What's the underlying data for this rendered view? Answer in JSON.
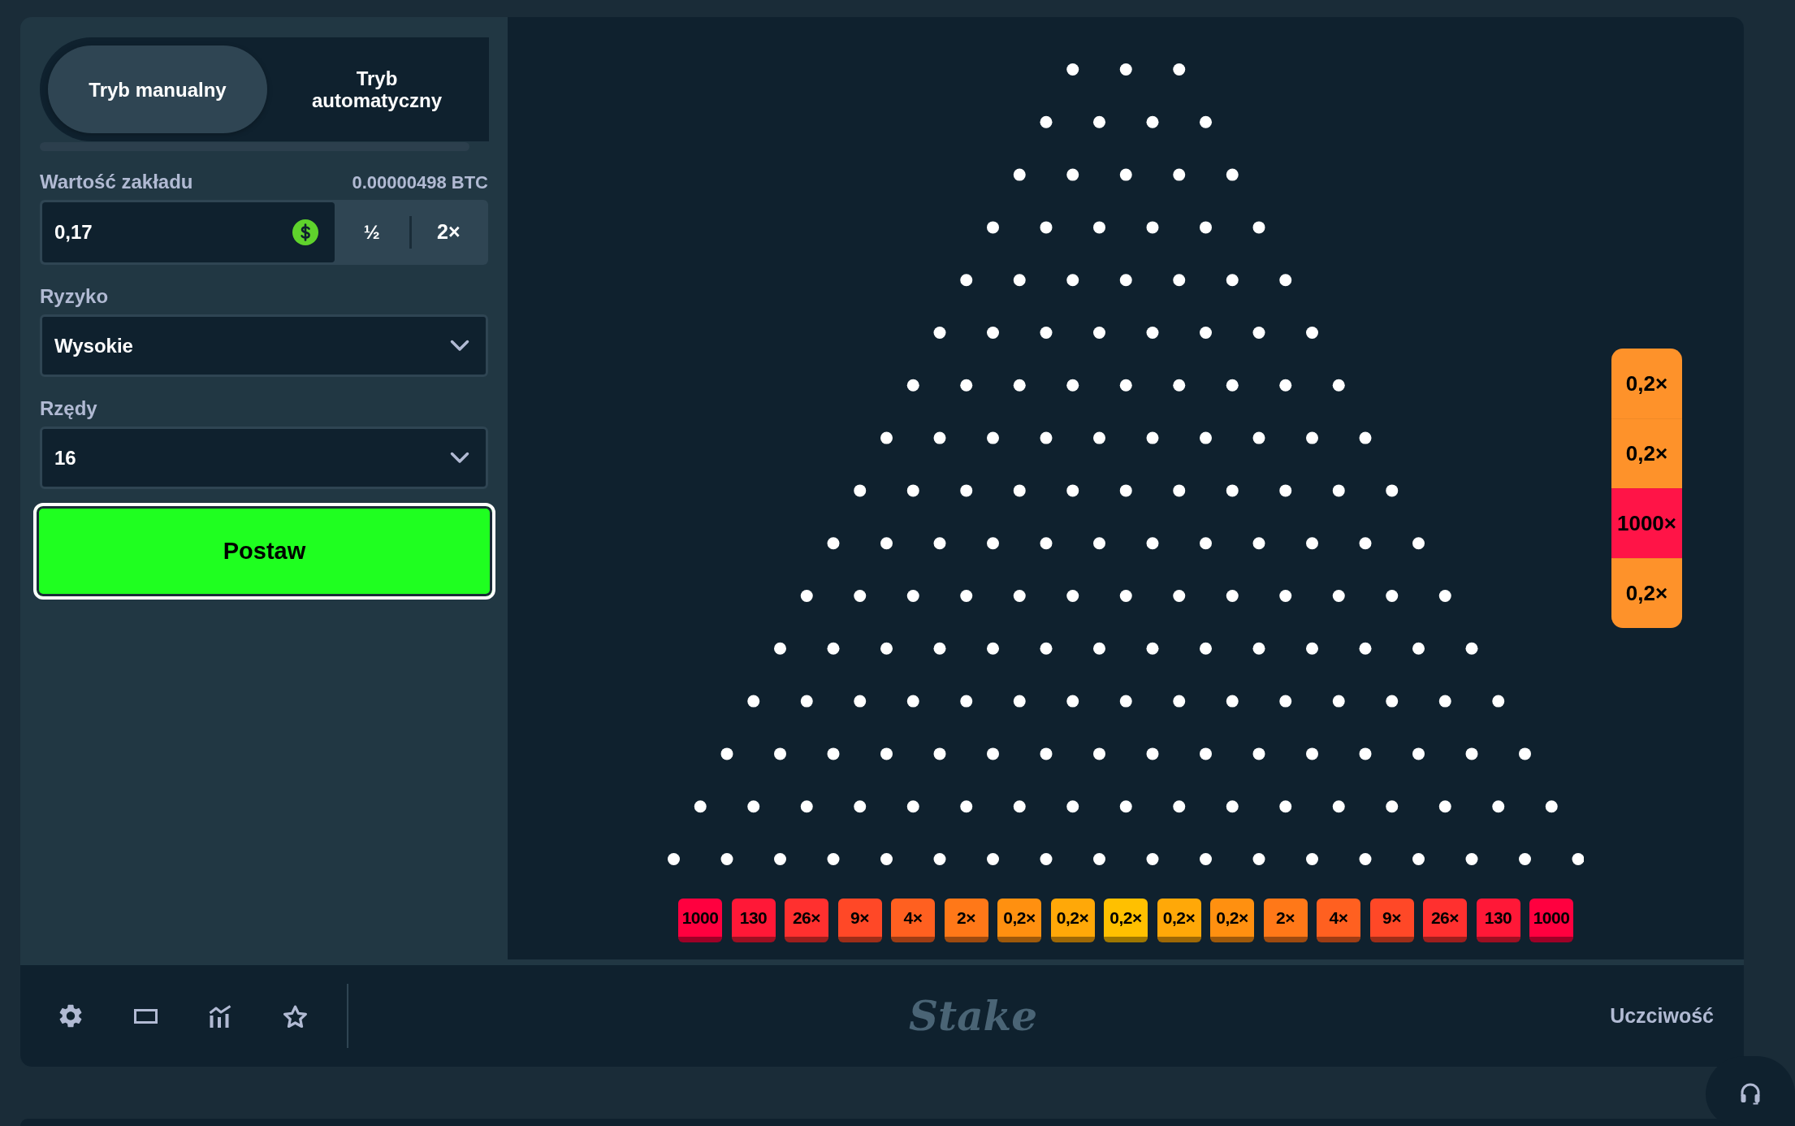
{
  "mode_tabs": [
    {
      "label": "Tryb manualny",
      "selected": true
    },
    {
      "label": "Tryb automatyczny",
      "selected": false
    }
  ],
  "bet_amount": {
    "label": "Wartość zakładu",
    "crypto_value": "0.00000498 BTC",
    "value": "0,17",
    "half_button": "½",
    "double_button": "2×"
  },
  "risk": {
    "label": "Ryzyko",
    "value": "Wysokie"
  },
  "row_count": {
    "label": "Rzędy",
    "value": "16"
  },
  "bet_button": "Postaw",
  "board": {
    "multipliers": [
      {
        "label": "1000",
        "color": "#ff003f"
      },
      {
        "label": "130",
        "color": "#ff1837"
      },
      {
        "label": "26×",
        "color": "#ff302f"
      },
      {
        "label": "9×",
        "color": "#ff4827"
      },
      {
        "label": "4×",
        "color": "#ff6020"
      },
      {
        "label": "2×",
        "color": "#ff7818"
      },
      {
        "label": "0,2×",
        "color": "#ff9010"
      },
      {
        "label": "0,2×",
        "color": "#ffa808"
      },
      {
        "label": "0,2×",
        "color": "#ffc000"
      },
      {
        "label": "0,2×",
        "color": "#ffa808"
      },
      {
        "label": "0,2×",
        "color": "#ff9010"
      },
      {
        "label": "2×",
        "color": "#ff7818"
      },
      {
        "label": "4×",
        "color": "#ff6020"
      },
      {
        "label": "9×",
        "color": "#ff4827"
      },
      {
        "label": "26×",
        "color": "#ff302f"
      },
      {
        "label": "130",
        "color": "#ff1837"
      },
      {
        "label": "1000",
        "color": "#ff003f"
      }
    ]
  },
  "history": [
    {
      "label": "0,2×",
      "color": "#fe922a"
    },
    {
      "label": "0,2×",
      "color": "#fe922a"
    },
    {
      "label": "1000×",
      "color": "#ff1447"
    },
    {
      "label": "0,2×",
      "color": "#fe922a"
    }
  ],
  "footer": {
    "logo": "Stake",
    "fairness_link": "Uczciwość"
  }
}
